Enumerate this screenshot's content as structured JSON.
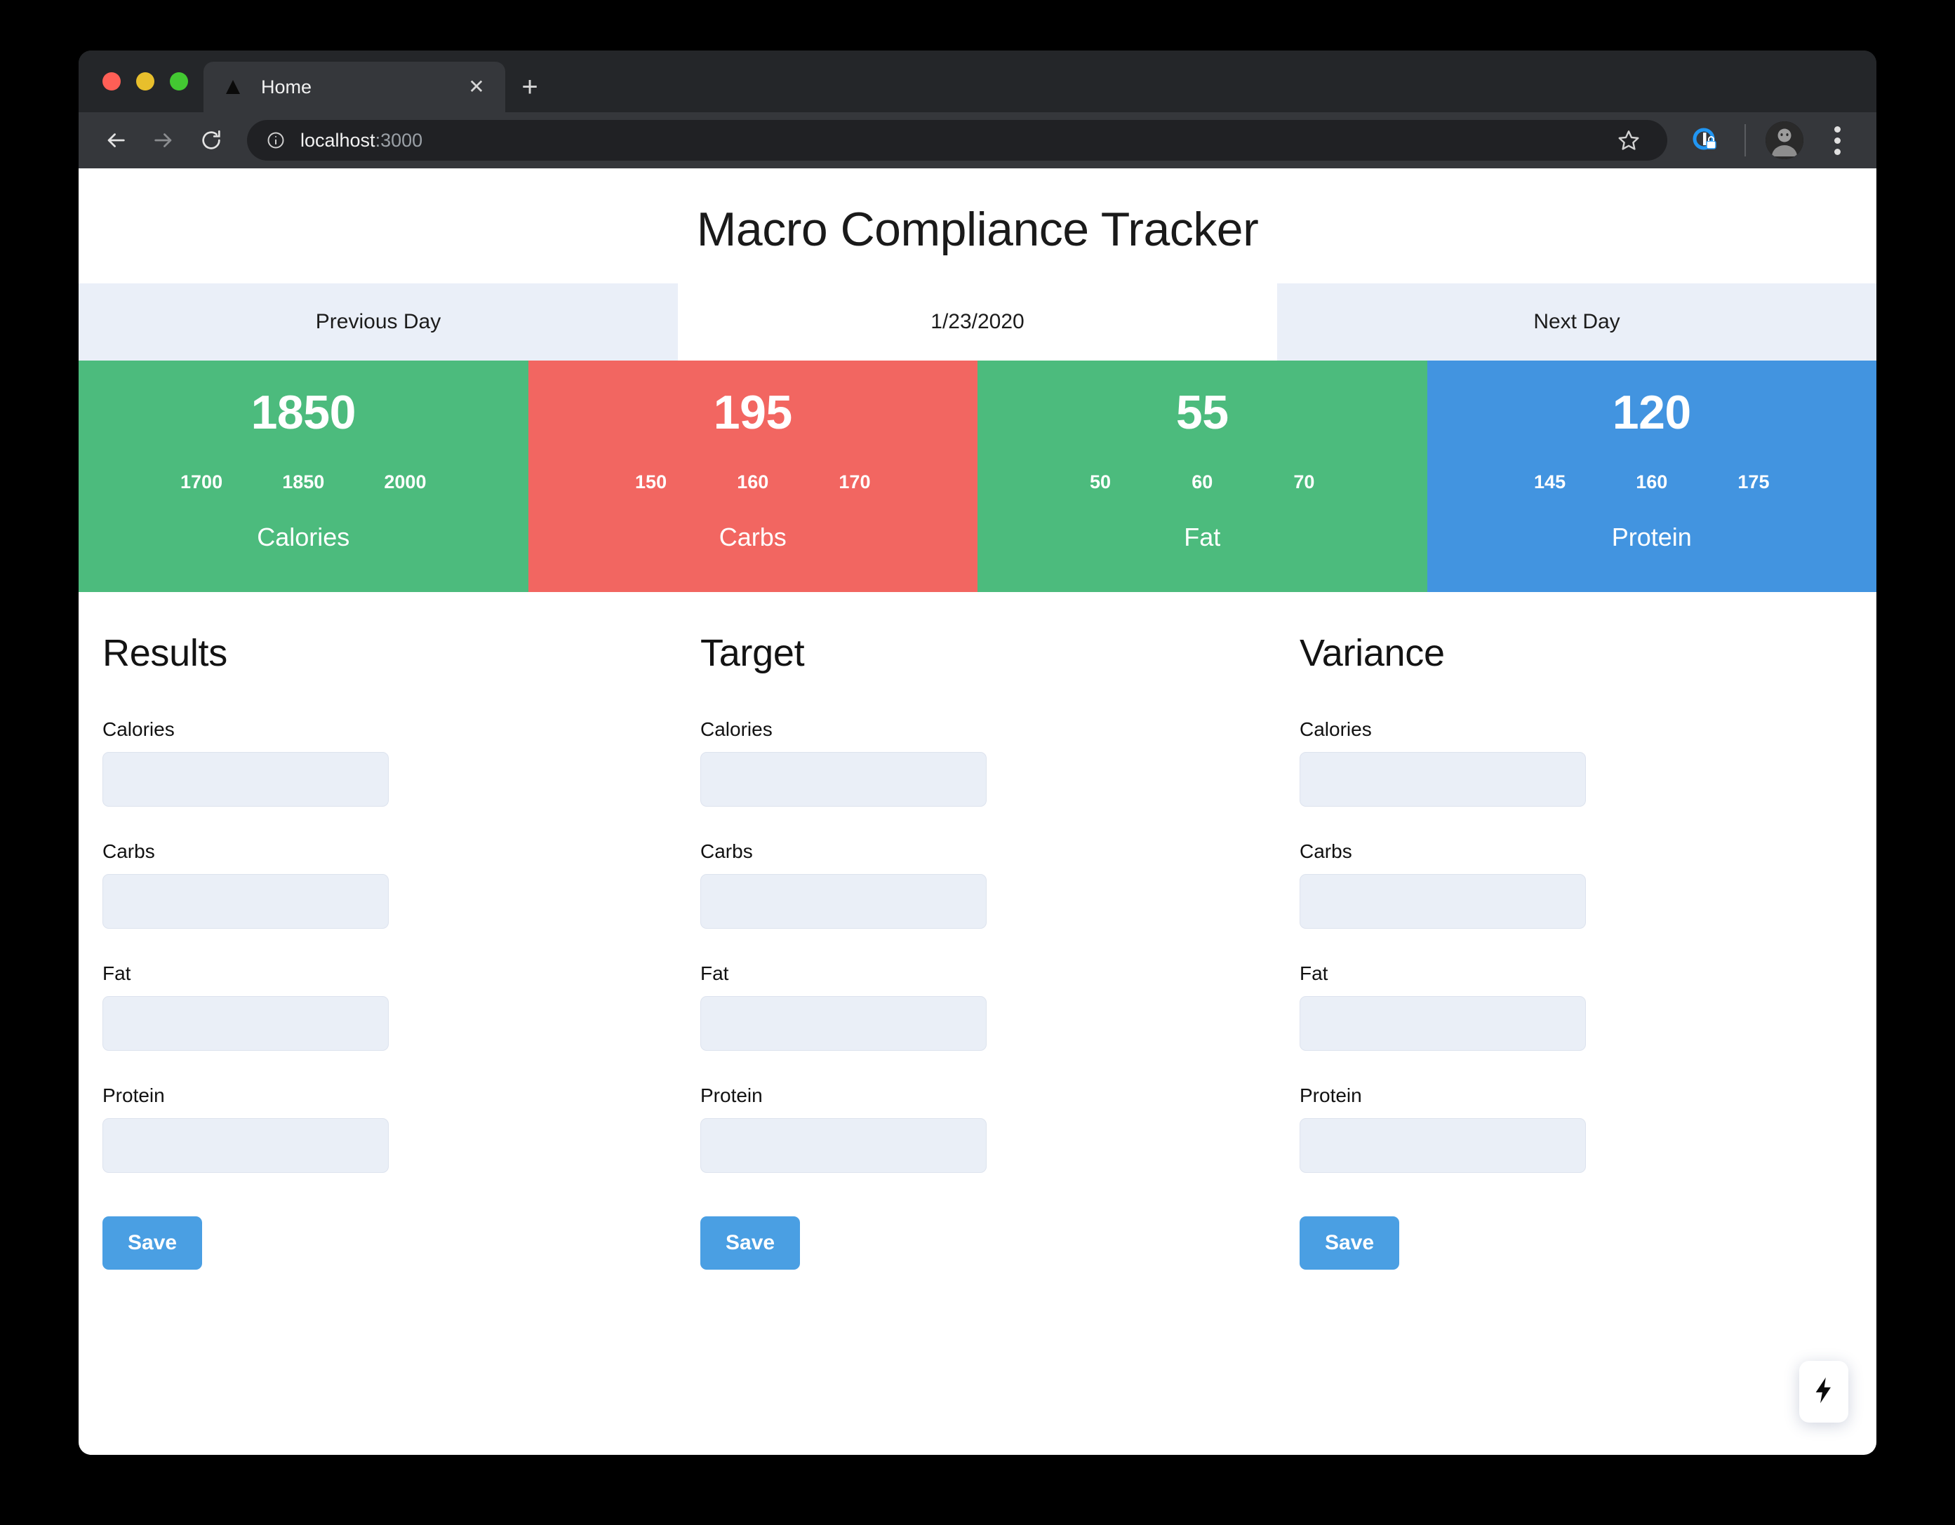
{
  "browser": {
    "tab": {
      "title": "Home",
      "favicon": "triangle-favicon",
      "close_label": "✕"
    },
    "new_tab_label": "+",
    "address": {
      "url_host": "localhost",
      "url_port": ":3000",
      "full_url": "localhost:3000"
    },
    "icons": {
      "back": "back-arrow-icon",
      "forward": "forward-arrow-icon",
      "reload": "reload-icon",
      "info": "info-circle-icon",
      "star": "bookmark-star-icon",
      "extension": "extension-icon",
      "avatar": "profile-avatar",
      "menu": "kebab-menu-icon"
    }
  },
  "page": {
    "title": "Macro Compliance Tracker",
    "day_nav": {
      "previous_label": "Previous Day",
      "date": "1/23/2020",
      "next_label": "Next Day"
    },
    "macro_cards": [
      {
        "label": "Calories",
        "value": "1850",
        "range_low": "1700",
        "range_mid": "1850",
        "range_high": "2000",
        "color": "#4cbb7d",
        "status": "compliant"
      },
      {
        "label": "Carbs",
        "value": "195",
        "range_low": "150",
        "range_mid": "160",
        "range_high": "170",
        "color": "#f26661",
        "status": "over"
      },
      {
        "label": "Fat",
        "value": "55",
        "range_low": "50",
        "range_mid": "60",
        "range_high": "70",
        "color": "#4cbb7d",
        "status": "compliant"
      },
      {
        "label": "Protein",
        "value": "120",
        "range_low": "145",
        "range_mid": "160",
        "range_high": "175",
        "color": "#4294e0",
        "status": "under"
      }
    ],
    "forms": [
      {
        "heading": "Results",
        "fields": [
          {
            "label": "Calories",
            "value": "",
            "placeholder": ""
          },
          {
            "label": "Carbs",
            "value": "",
            "placeholder": ""
          },
          {
            "label": "Fat",
            "value": "",
            "placeholder": ""
          },
          {
            "label": "Protein",
            "value": "",
            "placeholder": ""
          }
        ],
        "save_label": "Save"
      },
      {
        "heading": "Target",
        "fields": [
          {
            "label": "Calories",
            "value": "",
            "placeholder": ""
          },
          {
            "label": "Carbs",
            "value": "",
            "placeholder": ""
          },
          {
            "label": "Fat",
            "value": "",
            "placeholder": ""
          },
          {
            "label": "Protein",
            "value": "",
            "placeholder": ""
          }
        ],
        "save_label": "Save"
      },
      {
        "heading": "Variance",
        "fields": [
          {
            "label": "Calories",
            "value": "",
            "placeholder": ""
          },
          {
            "label": "Carbs",
            "value": "",
            "placeholder": ""
          },
          {
            "label": "Fat",
            "value": "",
            "placeholder": ""
          },
          {
            "label": "Protein",
            "value": "",
            "placeholder": ""
          }
        ],
        "save_label": "Save"
      }
    ],
    "floating_widget": {
      "icon": "lightning-bolt-icon"
    },
    "colors": {
      "accent_blue": "#4a9fe3",
      "green": "#4cbb7d",
      "red": "#f26661",
      "blue": "#4294e0",
      "input_bg": "#eaeff7",
      "nav_btn_bg": "#eaeff8"
    }
  }
}
